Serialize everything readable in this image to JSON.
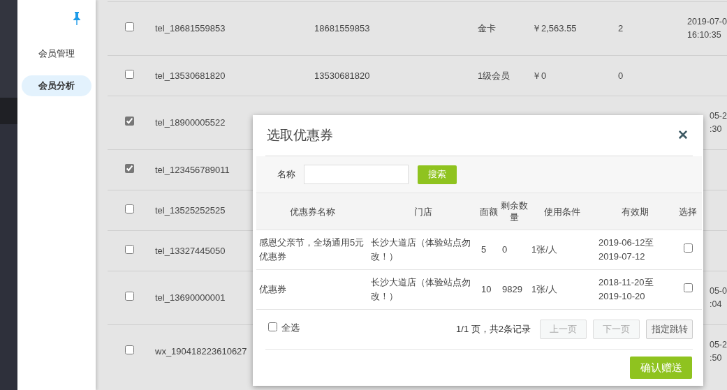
{
  "sidebar": {
    "items": [
      {
        "label": "会员管理",
        "selected": false
      },
      {
        "label": "会员分析",
        "selected": true
      }
    ]
  },
  "members": {
    "rows": [
      {
        "checked": false,
        "account": "tel_18681559853",
        "phone": "18681559853",
        "level": "金卡",
        "balance": "￥2,563.55",
        "count": "2",
        "date": [
          "2019-07-0",
          "16:10:35"
        ]
      },
      {
        "checked": false,
        "account": "tel_13530681820",
        "phone": "13530681820",
        "level": "1级会员",
        "balance": "￥0",
        "count": "0"
      },
      {
        "checked": true,
        "account": "tel_18900005522",
        "date": [
          "05-2",
          ":30"
        ]
      },
      {
        "checked": true,
        "account": "tel_123456789011"
      },
      {
        "checked": false,
        "account": "tel_13525252525"
      },
      {
        "checked": false,
        "account": "tel_13327445050"
      },
      {
        "checked": false,
        "account": "tel_13690000001",
        "date": [
          "05-0",
          ":04"
        ]
      },
      {
        "checked": false,
        "account": "wx_190418223610627",
        "date": [
          "05-2",
          ":50"
        ]
      }
    ]
  },
  "dialog": {
    "title": "选取优惠券",
    "close": "✕",
    "search": {
      "label": "名称",
      "button": "搜索"
    },
    "columns": [
      "优惠券名称",
      "门店",
      "面额",
      "剩余数量",
      "使用条件",
      "有效期",
      "选择"
    ],
    "rows": [
      {
        "name": "感恩父亲节，全场通用5元优惠券",
        "store": "长沙大道店（体验站点勿改！）",
        "face_value": "5",
        "remaining": "0",
        "condition": "1张/人",
        "validity": "2019-06-12至2019-07-12",
        "checked": false
      },
      {
        "name": "优惠券",
        "store": "长沙大道店（体验站点勿改！）",
        "face_value": "10",
        "remaining": "9829",
        "condition": "1张/人",
        "validity": "2018-11-20至2019-10-20",
        "checked": false
      }
    ],
    "select_all": {
      "label": "全选",
      "checked": false
    },
    "pager_info": "1/1 页，共2条记录",
    "pager_buttons": [
      {
        "label": "上一页",
        "disabled": true
      },
      {
        "label": "下一页",
        "disabled": true
      },
      {
        "label": "指定跳转",
        "disabled": false
      }
    ],
    "confirm": "确认赠送"
  }
}
